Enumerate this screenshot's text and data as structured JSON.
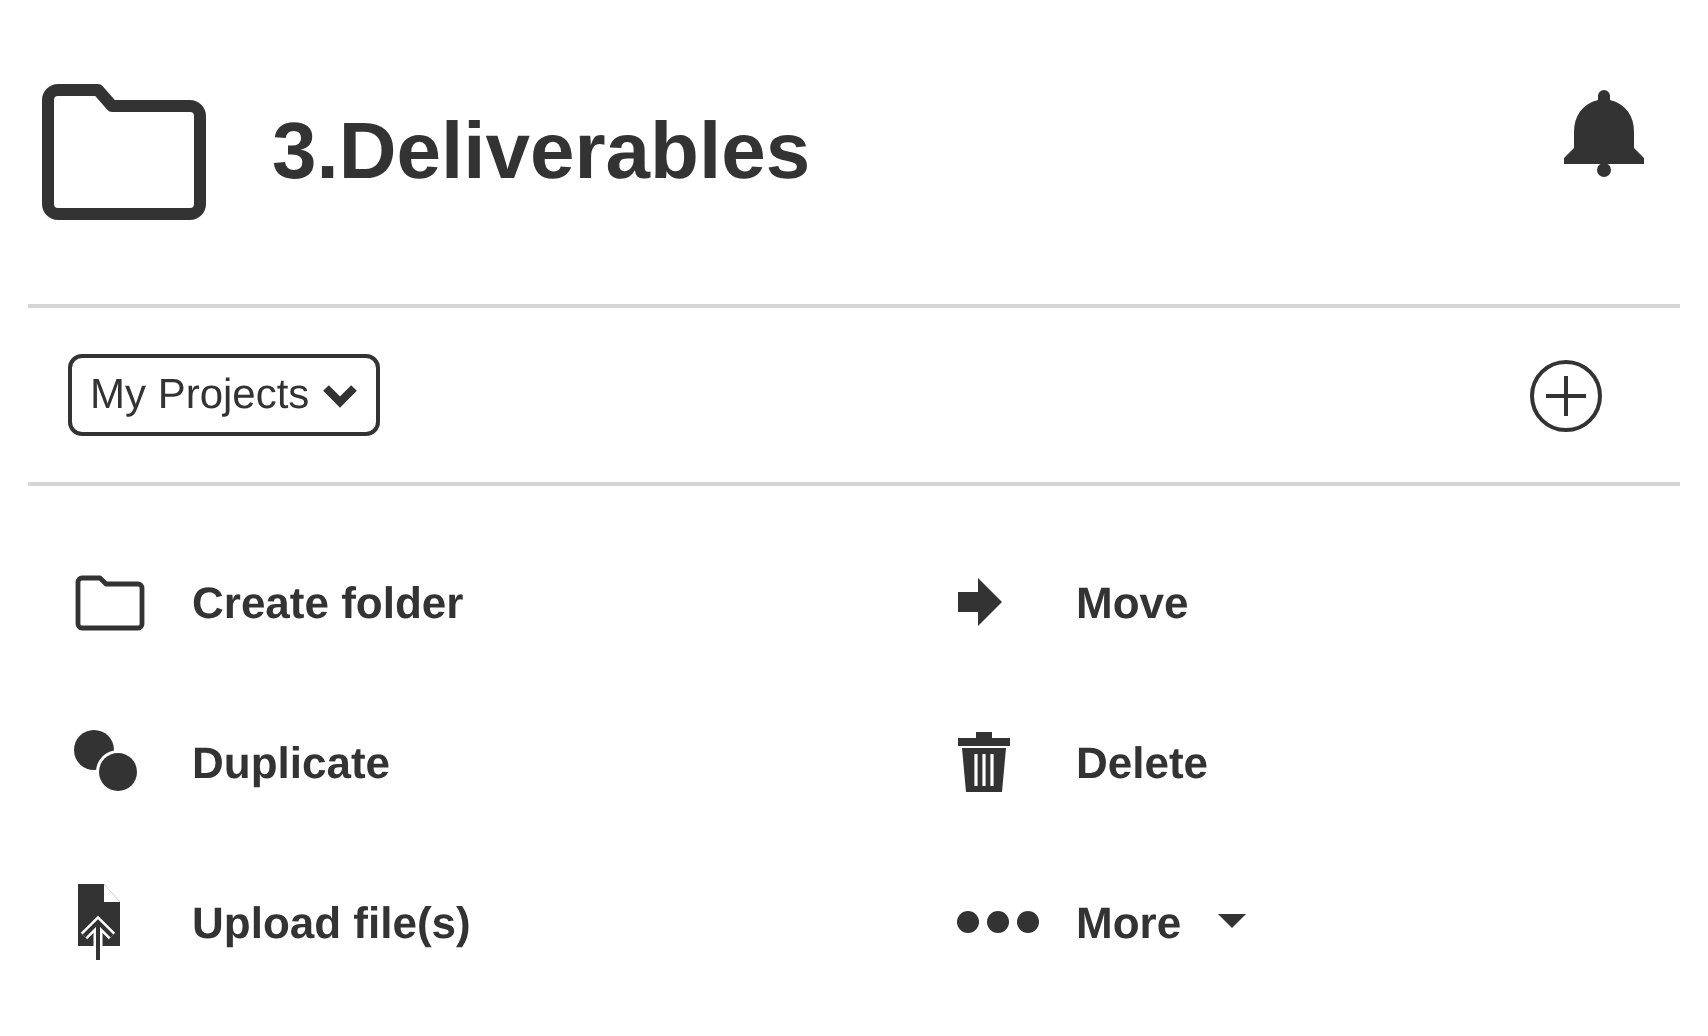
{
  "header": {
    "title": "3.Deliverables"
  },
  "project_selector": {
    "value": "My Projects"
  },
  "actions": [
    {
      "label": "Create folder",
      "kind": "folder"
    },
    {
      "label": "Move",
      "kind": "move"
    },
    {
      "label": "Duplicate",
      "kind": "duplicate"
    },
    {
      "label": "Delete",
      "kind": "delete"
    },
    {
      "label": "Upload file(s)",
      "kind": "upload"
    },
    {
      "label": "More",
      "kind": "more"
    }
  ]
}
